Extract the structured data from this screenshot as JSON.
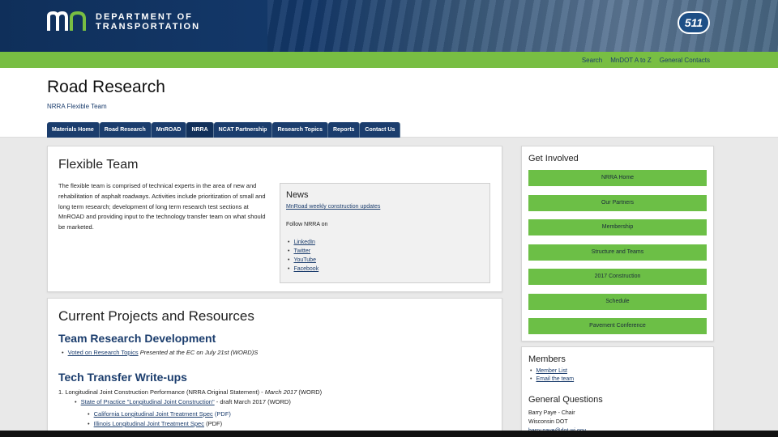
{
  "header": {
    "logo_text_line1": "DEPARTMENT OF",
    "logo_text_line2": "TRANSPORTATION",
    "badge_511": "511",
    "util_links": [
      "Search",
      "MnDOT A to Z",
      "General Contacts"
    ]
  },
  "page": {
    "title": "Road Research",
    "breadcrumb": "NRRA Flexible Team"
  },
  "tabs": [
    "Materials Home",
    "Road Research",
    "MnROAD",
    "NRRA",
    "NCAT Partnership",
    "Research Topics",
    "Reports",
    "Contact Us"
  ],
  "flexible": {
    "heading": "Flexible Team",
    "description": "The flexible team is comprised of technical experts in the area of new and rehabilitation of asphalt roadways. Activities include prioritization of small and long term research; development of long term research test sections at MnROAD and providing input to the technology transfer team on what should be marketed."
  },
  "news": {
    "heading": "News",
    "link": "MnRoad weekly construction updates",
    "follow_label": "Follow NRRA on",
    "social": [
      "LinkedIn",
      "Twitter",
      "YouTube",
      "Facebook"
    ]
  },
  "current": {
    "heading": "Current Projects and Resources",
    "team_heading": "Team Research Development",
    "voted_link": "Voted on Research Topics",
    "voted_text": "Presented at the EC on July 21st (WORD)S",
    "tech_heading": "Tech Transfer Write-ups",
    "item1_text": "1.  Longitudinal Joint Construction Performance (NRRA Original Statement) -",
    "item1_date": "March 2017",
    "item1_tail": "(WORD)",
    "item2_link": "State of Practice \"Longitudinal Joint Construction\"",
    "item2_tail": "- draft March 2017 (WORD)",
    "item3_link": "California Longitudinal Joint Treatment Spec",
    "item3_tail": "(PDF)",
    "item4_link": "Illinois Longitudinal Joint Treatment Spec",
    "item4_tail": "(PDF)"
  },
  "get_involved": {
    "heading": "Get Involved",
    "buttons": [
      "NRRA Home",
      "Our Partners",
      "Membership",
      "Structure and Teams",
      "2017 Construction",
      "Schedule",
      "Pavement Conference"
    ]
  },
  "members": {
    "heading": "Members",
    "links": [
      "Member List",
      "Email the team"
    ]
  },
  "general_questions": {
    "heading": "General Questions",
    "name": "Barry Paye - Chair",
    "org": "Wisconsin DOT",
    "email": "barry.paye@dot.wi.gov"
  },
  "colors": {
    "navy": "#1b3d6d",
    "green": "#78be43",
    "button_green": "#6cbf46"
  }
}
